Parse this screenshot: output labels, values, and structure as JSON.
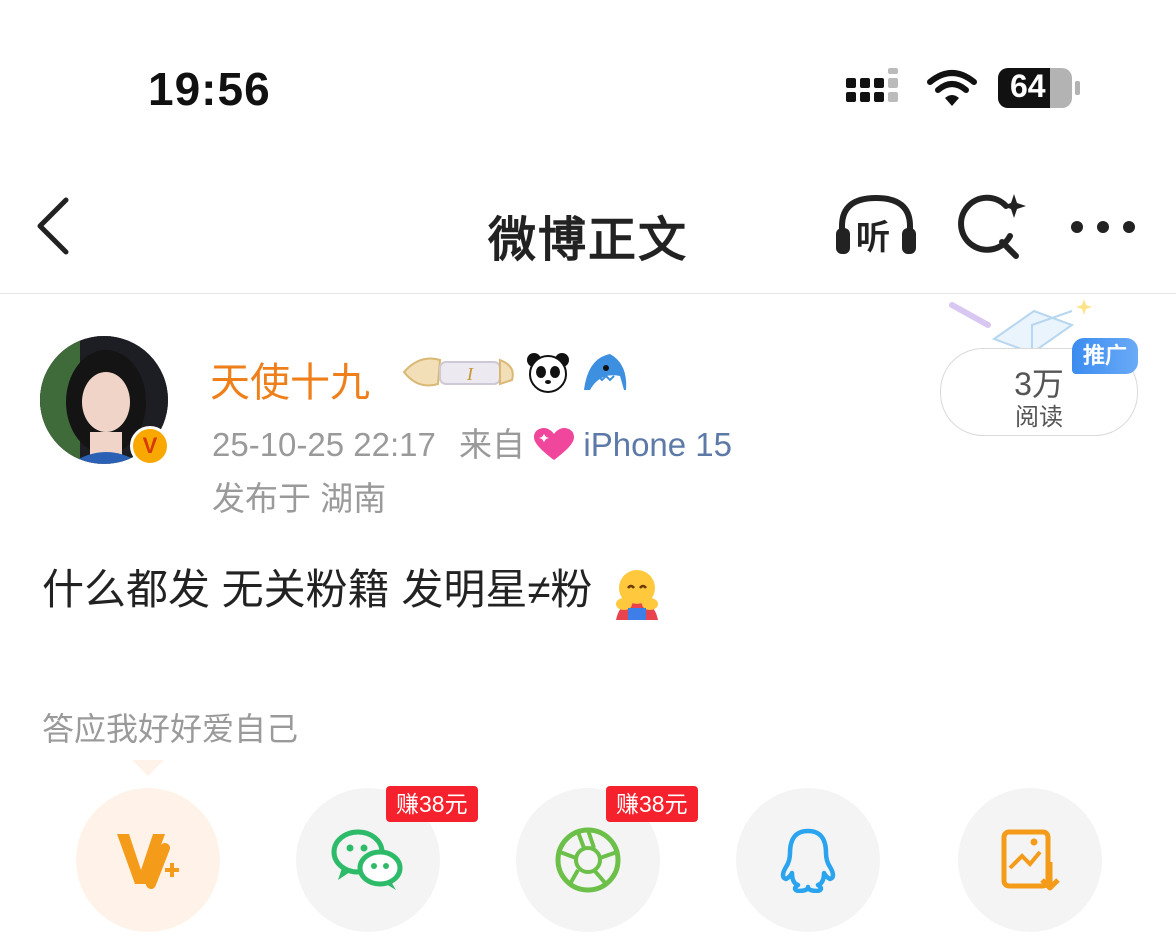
{
  "status_bar": {
    "time": "19:56",
    "battery": "64"
  },
  "nav": {
    "title": "微博正文",
    "listen_label": "听"
  },
  "post": {
    "author": "天使十九",
    "badge_letter": "I",
    "verified_mark": "V",
    "time": "25-10-25 22:17",
    "source_prefix": "来自",
    "source_device": "iPhone 15",
    "location": "发布于 湖南",
    "read_count": "3万",
    "read_label": "阅读",
    "promo_tag": "推广",
    "text": "什么都发 无关粉籍 发明星≠粉",
    "sub_text": "答应我好好爱自己"
  },
  "share": {
    "items": [
      {
        "icon": "v-plus-icon"
      },
      {
        "icon": "wechat-icon",
        "tag": "赚38元"
      },
      {
        "icon": "moments-icon",
        "tag": "赚38元"
      },
      {
        "icon": "qq-icon"
      },
      {
        "icon": "save-image-icon"
      }
    ]
  },
  "colors": {
    "username": "#ef7f1a",
    "source": "#5c79a8",
    "earn_tag": "#f5222d",
    "wechat": "#2dbb6a",
    "moments": "#6cc04a",
    "qq": "#2aa4ee",
    "save": "#f49b1a"
  }
}
